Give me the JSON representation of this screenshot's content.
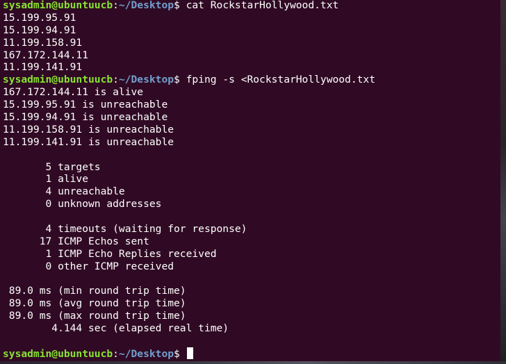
{
  "terminal": {
    "colors": {
      "background": "#300a24",
      "user_host": "#8ae234",
      "path": "#729fcf",
      "text": "#ffffff"
    },
    "prompt": {
      "user_host": "sysadmin@ubuntuucb",
      "colon": ":",
      "path": "~/Desktop",
      "dollar": "$"
    },
    "commands": {
      "cmd1": " cat RockstarHollywood.txt",
      "cmd2": " fping -s <RockstarHollywood.txt"
    },
    "cat_output": [
      "15.199.95.91",
      "15.199.94.91",
      "11.199.158.91",
      "167.172.144.11",
      "11.199.141.91"
    ],
    "fping_results": [
      "167.172.144.11 is alive",
      "15.199.95.91 is unreachable",
      "15.199.94.91 is unreachable",
      "11.199.158.91 is unreachable",
      "11.199.141.91 is unreachable"
    ],
    "stats_targets": [
      "       5 targets",
      "       1 alive",
      "       4 unreachable",
      "       0 unknown addresses"
    ],
    "stats_icmp": [
      "       4 timeouts (waiting for response)",
      "      17 ICMP Echos sent",
      "       1 ICMP Echo Replies received",
      "       0 other ICMP received"
    ],
    "stats_timing": [
      " 89.0 ms (min round trip time)",
      " 89.0 ms (avg round trip time)",
      " 89.0 ms (max round trip time)",
      "        4.144 sec (elapsed real time)"
    ]
  }
}
